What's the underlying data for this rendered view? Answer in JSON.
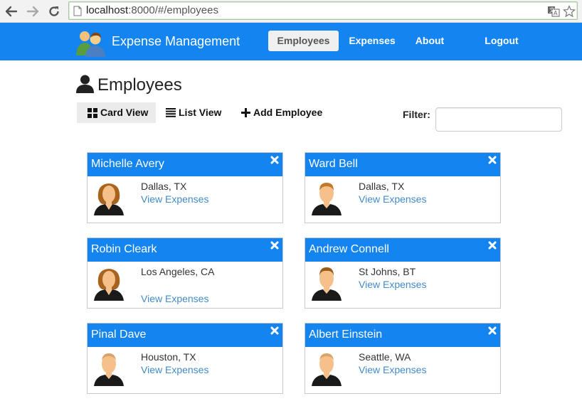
{
  "browser": {
    "url_host": "localhost",
    "url_rest": ":8000/#/employees"
  },
  "navbar": {
    "brand_title": "Expense Management",
    "items": [
      {
        "label": "Employees",
        "active": true
      },
      {
        "label": "Expenses",
        "active": false
      },
      {
        "label": "About",
        "active": false
      },
      {
        "label": "Logout",
        "active": false
      }
    ]
  },
  "page": {
    "title": "Employees",
    "icon": "user-icon"
  },
  "toolbar": {
    "card_view_label": "Card View",
    "list_view_label": "List View",
    "add_employee_label": "Add Employee",
    "filter_label": "Filter:",
    "filter_value": ""
  },
  "colors": {
    "brand_blue": "#1384f0",
    "link_blue": "#428bca"
  },
  "employees": [
    {
      "name": "Michelle Avery",
      "location": "Dallas, TX",
      "link": "View Expenses",
      "avatar": "female-avatar"
    },
    {
      "name": "Ward Bell",
      "location": "Dallas, TX",
      "link": "View Expenses",
      "avatar": "male-avatar"
    },
    {
      "name": "Robin Cleark",
      "location": "Los Angeles, CA",
      "link": "View Expenses",
      "avatar": "female-avatar"
    },
    {
      "name": "Andrew Connell",
      "location": "St Johns, BT",
      "link": "View Expenses",
      "avatar": "male-avatar"
    },
    {
      "name": "Pinal Dave",
      "location": "Houston, TX",
      "link": "View Expenses",
      "avatar": "male-avatar"
    },
    {
      "name": "Albert Einstein",
      "location": "Seattle, WA",
      "link": "View Expenses",
      "avatar": "male-avatar"
    }
  ]
}
